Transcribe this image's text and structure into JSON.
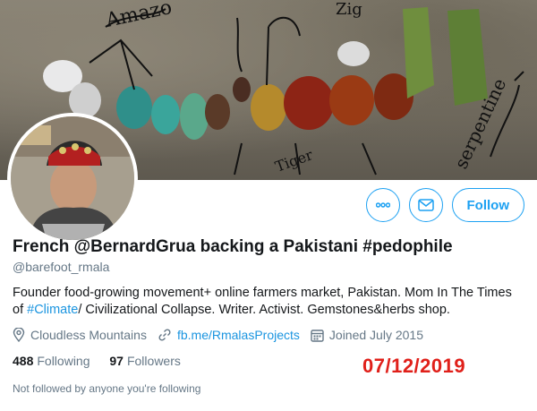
{
  "banner": {
    "annotations": [
      "Amazo",
      "Zig",
      "serpentine",
      "Tiger"
    ]
  },
  "header": {
    "display_name": "French @BernardGrua backing a Pakistani #pedophile",
    "handle": "@barefoot_rmala"
  },
  "actions": {
    "more_icon": "ellipsis-icon",
    "message_icon": "envelope-icon",
    "follow_label": "Follow"
  },
  "bio": {
    "text_before": "Founder food-growing movement+ online farmers market, Pakistan. Mom In The Times of ",
    "hashtag": "#Climate",
    "text_after": "/ Civilizational Collapse. Writer. Activist. Gemstones&herbs shop."
  },
  "meta": {
    "location": "Cloudless Mountains",
    "website": "fb.me/RmalasProjects",
    "joined": "Joined July 2015"
  },
  "stats": {
    "following_count": "488",
    "following_label": "Following",
    "followers_count": "97",
    "followers_label": "Followers"
  },
  "date_stamp": "07/12/2019",
  "not_followed_text": "Not followed by anyone you're following",
  "colors": {
    "accent": "#1da1f2",
    "stamp": "#e0201a"
  }
}
